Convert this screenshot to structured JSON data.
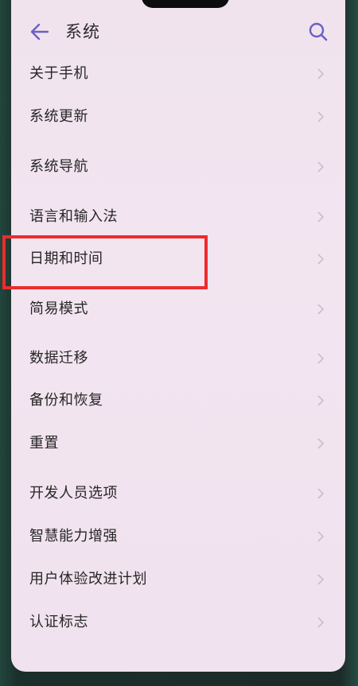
{
  "header": {
    "title": "系统"
  },
  "items": [
    {
      "label": "关于手机"
    },
    {
      "label": "系统更新"
    },
    {
      "label": "系统导航"
    },
    {
      "label": "语言和输入法"
    },
    {
      "label": "日期和时间"
    },
    {
      "label": "简易模式"
    },
    {
      "label": "数据迁移"
    },
    {
      "label": "备份和恢复"
    },
    {
      "label": "重置"
    },
    {
      "label": "开发人员选项"
    },
    {
      "label": "智慧能力增强"
    },
    {
      "label": "用户体验改进计划"
    },
    {
      "label": "认证标志"
    }
  ],
  "highlighted_item": "日期和时间",
  "colors": {
    "accent": "#6b5fc7",
    "highlight": "#ee2b2b",
    "background": "#f1e4ef"
  },
  "icons": {
    "back": "arrow-left-icon",
    "search": "search-icon",
    "chevron": "chevron-right-icon"
  }
}
